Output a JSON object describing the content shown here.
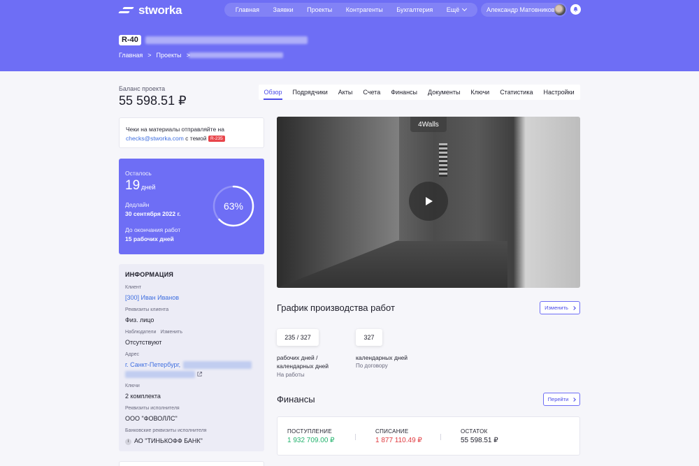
{
  "header": {
    "logo_text": "stworka",
    "nav": [
      "Главная",
      "Заявки",
      "Проекты",
      "Контрагенты",
      "Бухгалтерия",
      "Ещё"
    ],
    "user_name": "Александр Матовников",
    "project_badge": "R-40",
    "breadcrumb": [
      "Главная",
      ">",
      "Проекты",
      ">"
    ]
  },
  "balance": {
    "label": "Баланс проекта",
    "value": "55 598.51 ₽"
  },
  "checks": {
    "text_before": "Чеки на материалы отправляйте на",
    "email": "checks@stworka.com",
    "text_after": "с темой",
    "tag": "R-235"
  },
  "deadline": {
    "remaining_label": "Осталось",
    "remaining_days": "19",
    "remaining_unit": "дней",
    "deadline_label": "Дедлайн",
    "deadline_date": "30 сентября 2022 г.",
    "work_end_label": "До окончания работ",
    "work_end_value": "15 рабочих дней",
    "progress_text": "63%",
    "progress": 0.63
  },
  "info": {
    "title": "ИНФОРМАЦИЯ",
    "client_label": "Клиент",
    "client_value": "[300] Иван Иванов",
    "client_req_label": "Реквизиты клиента",
    "client_req_value": "Физ. лицо",
    "observers_label": "Наблюдатели",
    "observers_edit": "Изменить",
    "observers_value": "Отсутствуют",
    "address_label": "Адрес",
    "address_value": "г. Санкт-Петербург,",
    "keys_label": "Ключи",
    "keys_value": "2 комплекта",
    "executor_req_label": "Реквизиты исполнителя",
    "executor_req_value": "ООО \"ФОВОЛЛС\"",
    "bank_label": "Банковские реквизиты исполнителя",
    "bank_value": "АО \"ТИНЬКОФФ БАНК\"",
    "bank_icon": "i"
  },
  "tabs": [
    "Обзор",
    "Подрядчики",
    "Акты",
    "Счета",
    "Финансы",
    "Документы",
    "Ключи",
    "Статистика",
    "Настройки"
  ],
  "video": {
    "label": "4Walls"
  },
  "schedule": {
    "title": "График производства работ",
    "button": "Изменить",
    "stat1_value": "235 / 327",
    "stat1_desc_line1": "рабочих дней /",
    "stat1_desc_line2": "календарных дней",
    "stat1_sub": "На работы",
    "stat2_value": "327",
    "stat2_desc": "календарных дней",
    "stat2_sub": "По договору"
  },
  "finance": {
    "title": "Финансы",
    "button": "Перейти",
    "income_label": "ПОСТУПЛЕНИЕ",
    "income_value": "1 932 709.00 ₽",
    "expense_label": "СПИСАНИЕ",
    "expense_value": "1 877 110.49 ₽",
    "rest_label": "ОСТАТОК",
    "rest_value": "55 598.51 ₽",
    "income_color": "#23b26d",
    "expense_color": "#e0393e"
  },
  "colors": {
    "brand": "#6e6ef5",
    "accent": "#4a4ae8",
    "link": "#3e6ee0"
  }
}
